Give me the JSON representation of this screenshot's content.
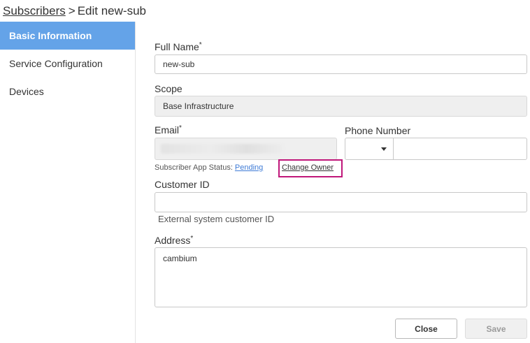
{
  "breadcrumb": {
    "parent": "Subscribers",
    "separator": ">",
    "current": "Edit new-sub"
  },
  "sidebar": {
    "items": [
      {
        "label": "Basic Information",
        "active": true
      },
      {
        "label": "Service Configuration",
        "active": false
      },
      {
        "label": "Devices",
        "active": false
      }
    ]
  },
  "form": {
    "full_name": {
      "label": "Full Name",
      "required_mark": "*",
      "value": "new-sub"
    },
    "scope": {
      "label": "Scope",
      "value": "Base Infrastructure"
    },
    "email": {
      "label": "Email",
      "required_mark": "*",
      "value": ""
    },
    "phone": {
      "label": "Phone Number",
      "code_value": "",
      "value": ""
    },
    "app_status": {
      "label": "Subscriber App Status:",
      "value": "Pending"
    },
    "change_owner": {
      "label": "Change Owner"
    },
    "customer_id": {
      "label": "Customer ID",
      "value": "",
      "helper": "External system customer ID"
    },
    "address": {
      "label": "Address",
      "required_mark": "*",
      "value": "cambium"
    }
  },
  "actions": {
    "close_label": "Close",
    "save_label": "Save"
  },
  "colors": {
    "sidebar_active_bg": "#64a3e8",
    "link": "#3e7bd6",
    "highlight_box": "#c0177a"
  }
}
